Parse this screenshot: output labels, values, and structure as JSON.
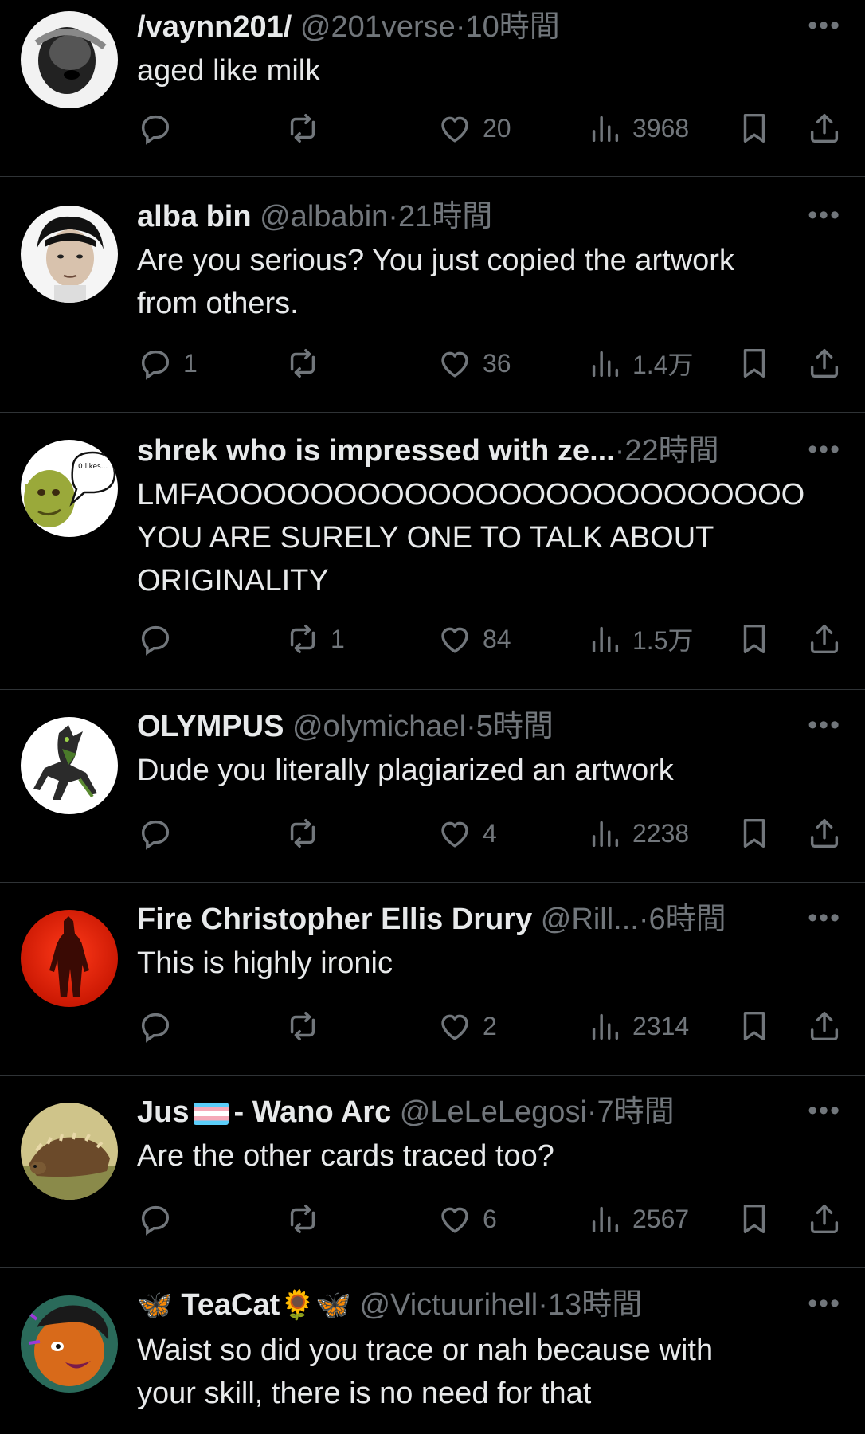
{
  "tweets": [
    {
      "name": "/vaynn201/",
      "handle": "@201verse",
      "time": "10時間",
      "text": "aged like milk",
      "replies": "",
      "retweets": "",
      "likes": "20",
      "views": "3968"
    },
    {
      "name": "alba bin",
      "handle": "@albabin",
      "time": "21時間",
      "text": "Are you serious? You just copied the artwork\nfrom others.",
      "replies": "1",
      "retweets": "",
      "likes": "36",
      "views": "1.4万"
    },
    {
      "name": "shrek who is impressed with ze...",
      "handle": "",
      "time": "22時間",
      "text": "LMFAOOOOOOOOOOOOOOOOOOOOOOOOO\nYOU ARE SURELY ONE TO TALK ABOUT\nORIGINALITY",
      "replies": "",
      "retweets": "1",
      "likes": "84",
      "views": "1.5万",
      "avatar_bubble_text": "0 likes..."
    },
    {
      "name": "OLYMPUS",
      "handle": "@olymichael",
      "time": "5時間",
      "text": "Dude you literally plagiarized an artwork",
      "replies": "",
      "retweets": "",
      "likes": "4",
      "views": "2238"
    },
    {
      "name": "Fire Christopher Ellis Drury",
      "handle": "@Rill...",
      "time": "6時間",
      "text": "This is highly ironic",
      "replies": "",
      "retweets": "",
      "likes": "2",
      "views": "2314"
    },
    {
      "name_part1": "Jus",
      "name_part2": "- Wano Arc",
      "handle": "@LeLeLegosi",
      "time": "7時間",
      "text": "Are the other cards traced too?",
      "replies": "",
      "retweets": "",
      "likes": "6",
      "views": "2567"
    },
    {
      "name_prefix_emoji": "🦋",
      "name": "TeaCat",
      "name_suffix_emoji": "🌻🦋",
      "handle": "@Victuurihell",
      "time": "13時間",
      "text": "Waist so did you trace or nah because with\nyour skill, there is no need for that"
    }
  ],
  "ui": {
    "dot": "·",
    "more": "•••"
  },
  "colors": {
    "background": "#000000",
    "primary_text": "#e7e9ea",
    "secondary_text": "#71767b",
    "divider": "#2f3336"
  }
}
